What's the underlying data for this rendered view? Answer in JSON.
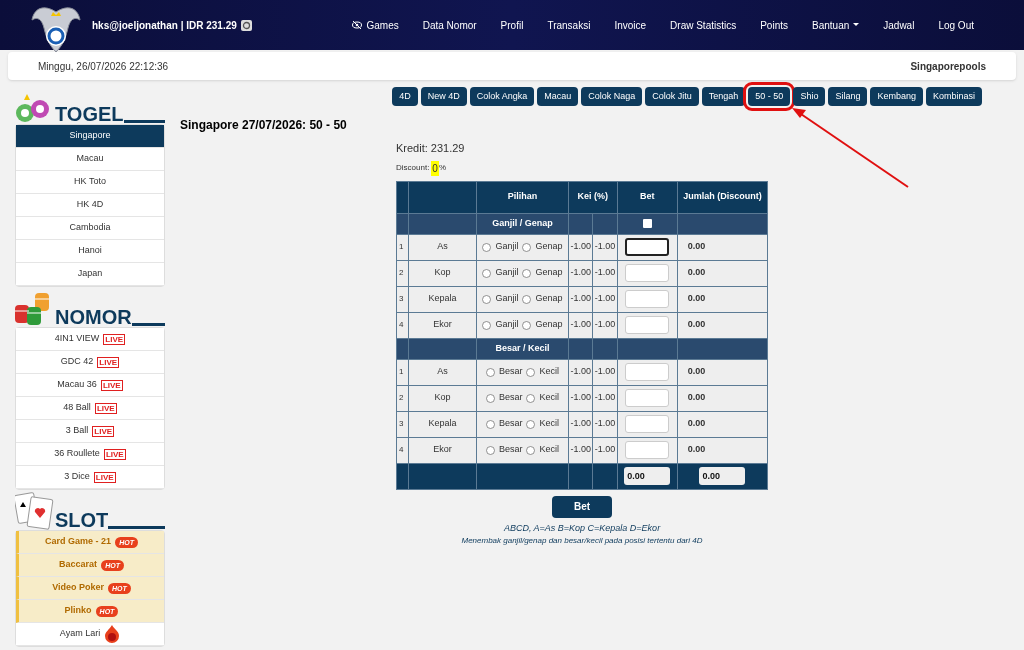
{
  "header": {
    "user_info": "hks@joeljonathan | IDR 231.29",
    "nav": [
      {
        "label": "Games",
        "kind": "icon"
      },
      {
        "label": "Data Nomor",
        "kind": "plain"
      },
      {
        "label": "Profil",
        "kind": "plain"
      },
      {
        "label": "Transaksi",
        "kind": "plain"
      },
      {
        "label": "Invoice",
        "kind": "plain"
      },
      {
        "label": "Draw Statistics",
        "kind": "plain"
      },
      {
        "label": "Points",
        "kind": "plain"
      },
      {
        "label": "Bantuan",
        "kind": "dropdown"
      },
      {
        "label": "Jadwal",
        "kind": "plain"
      },
      {
        "label": "Log Out",
        "kind": "plain"
      }
    ]
  },
  "date_bar": {
    "datetime": "Minggu, 26/07/2026 22:12:36",
    "market": "Singaporepools"
  },
  "sidebar": [
    {
      "title": "TOGEL",
      "kind": "balls",
      "items": [
        {
          "label": "Singapore",
          "selected": true
        },
        {
          "label": "Macau",
          "selected": false
        },
        {
          "label": "HK Toto",
          "selected": false
        },
        {
          "label": "HK 4D",
          "selected": false
        },
        {
          "label": "Cambodia",
          "selected": false
        },
        {
          "label": "Hanoi",
          "selected": false
        },
        {
          "label": "Japan",
          "selected": false
        }
      ]
    },
    {
      "title": "NOMOR",
      "kind": "chips",
      "items": [
        {
          "label": "4IN1 VIEW",
          "badge": "LIVE",
          "selected": false
        },
        {
          "label": "GDC 42",
          "badge": "LIVE",
          "selected": false
        },
        {
          "label": "Macau 36",
          "badge": "LIVE",
          "selected": false
        },
        {
          "label": "48 Ball",
          "badge": "LIVE",
          "selected": false
        },
        {
          "label": "3 Ball",
          "badge": "LIVE",
          "selected": false
        },
        {
          "label": "36 Roullete",
          "badge": "LIVE",
          "selected": false
        },
        {
          "label": "3 Dice",
          "badge": "LIVE",
          "selected": false
        }
      ]
    },
    {
      "title": "SLOT",
      "kind": "cards",
      "items": [
        {
          "label": "Card Game - 21",
          "badge": "HOT",
          "featured": true,
          "selected": false
        },
        {
          "label": "Baccarat",
          "badge": "HOT",
          "featured": true,
          "selected": false
        },
        {
          "label": "Video Poker",
          "badge": "HOT",
          "featured": true,
          "selected": false
        },
        {
          "label": "Plinko",
          "badge": "HOT",
          "featured": true,
          "selected": false
        },
        {
          "label": "Ayam Lari",
          "featured": false,
          "selected": false
        }
      ]
    }
  ],
  "tabs": [
    {
      "label": "4D",
      "highlighted": false
    },
    {
      "label": "New 4D",
      "highlighted": false
    },
    {
      "label": "Colok Angka",
      "highlighted": false
    },
    {
      "label": "Macau",
      "highlighted": false
    },
    {
      "label": "Colok Naga",
      "highlighted": false
    },
    {
      "label": "Colok Jitu",
      "highlighted": false
    },
    {
      "label": "Tengah",
      "highlighted": false
    },
    {
      "label": "50 - 50",
      "highlighted": true
    },
    {
      "label": "Shio",
      "highlighted": false
    },
    {
      "label": "Silang",
      "highlighted": false
    },
    {
      "label": "Kembang",
      "highlighted": false
    },
    {
      "label": "Kombinasi",
      "highlighted": false
    }
  ],
  "page_title": "Singapore 27/07/2026: 50 - 50",
  "kredit": "Kredit: 231.29",
  "discount": {
    "label": "Discount:",
    "value": "0",
    "unit": "%"
  },
  "table": {
    "columns": [
      "Pilihan",
      "Kei (%)",
      "Bet",
      "Jumlah (Discount)"
    ],
    "groups": [
      {
        "title": "Ganjil / Genap",
        "select_all_checked": false,
        "rows": [
          {
            "no": "1",
            "name": "As",
            "options": [
              {
                "label": "Ganjil",
                "checked": false
              },
              {
                "label": "Genap",
                "checked": false
              }
            ],
            "kei": [
              "-1.00",
              "-1.00"
            ],
            "focused": true,
            "jumlah": "0.00"
          },
          {
            "no": "2",
            "name": "Kop",
            "options": [
              {
                "label": "Ganjil",
                "checked": false
              },
              {
                "label": "Genap",
                "checked": false
              }
            ],
            "kei": [
              "-1.00",
              "-1.00"
            ],
            "focused": false,
            "jumlah": "0.00"
          },
          {
            "no": "3",
            "name": "Kepala",
            "options": [
              {
                "label": "Ganjil",
                "checked": false
              },
              {
                "label": "Genap",
                "checked": false
              }
            ],
            "kei": [
              "-1.00",
              "-1.00"
            ],
            "focused": false,
            "jumlah": "0.00"
          },
          {
            "no": "4",
            "name": "Ekor",
            "options": [
              {
                "label": "Ganjil",
                "checked": false
              },
              {
                "label": "Genap",
                "checked": false
              }
            ],
            "kei": [
              "-1.00",
              "-1.00"
            ],
            "focused": false,
            "jumlah": "0.00"
          }
        ]
      },
      {
        "title": "Besar / Kecil",
        "rows": [
          {
            "no": "1",
            "name": "As",
            "options": [
              {
                "label": "Besar",
                "checked": false
              },
              {
                "label": "Kecil",
                "checked": false
              }
            ],
            "kei": [
              "-1.00",
              "-1.00"
            ],
            "focused": false,
            "jumlah": "0.00"
          },
          {
            "no": "2",
            "name": "Kop",
            "options": [
              {
                "label": "Besar",
                "checked": false
              },
              {
                "label": "Kecil",
                "checked": false
              }
            ],
            "kei": [
              "-1.00",
              "-1.00"
            ],
            "focused": false,
            "jumlah": "0.00"
          },
          {
            "no": "3",
            "name": "Kepala",
            "options": [
              {
                "label": "Besar",
                "checked": false
              },
              {
                "label": "Kecil",
                "checked": false
              }
            ],
            "kei": [
              "-1.00",
              "-1.00"
            ],
            "focused": false,
            "jumlah": "0.00"
          },
          {
            "no": "4",
            "name": "Ekor",
            "options": [
              {
                "label": "Besar",
                "checked": false
              },
              {
                "label": "Kecil",
                "checked": false
              }
            ],
            "kei": [
              "-1.00",
              "-1.00"
            ],
            "focused": false,
            "jumlah": "0.00"
          }
        ]
      }
    ],
    "totals": [
      "0.00",
      "0.00"
    ]
  },
  "submit": "Bet",
  "notes": [
    "ABCD, A=As B=Kop C=Kepala D=Ekor",
    "Menembak ganjil/genap dan besar/kecil pada posisi tertentu dari 4D"
  ]
}
